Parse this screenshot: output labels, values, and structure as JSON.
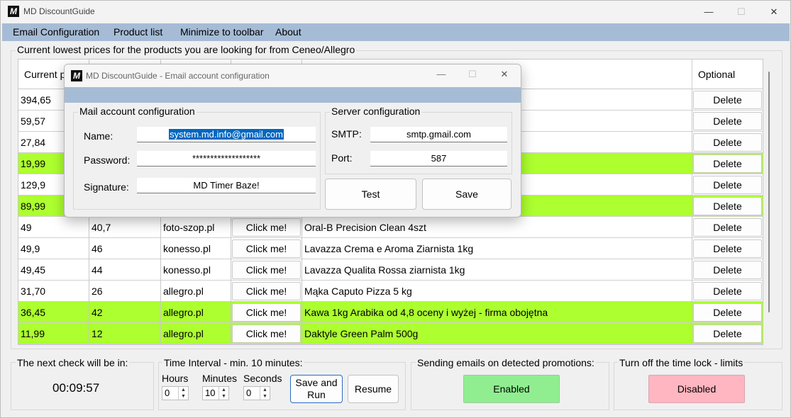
{
  "window": {
    "title": "MD DiscountGuide",
    "controls": {
      "minimize": "—",
      "maximize": "☐",
      "close": "✕"
    }
  },
  "menu": [
    "Email Configuration",
    "Product list",
    "Minimize to toolbar",
    "About"
  ],
  "main_group_label": "Current lowest prices for the products you are looking for from Ceneo/Allegro",
  "table": {
    "headers": [
      "Current p",
      "",
      "",
      "",
      "",
      "Optional"
    ],
    "rows": [
      {
        "price": "394,65",
        "c2": "",
        "shop": "",
        "link": "",
        "name": "",
        "action": "Delete",
        "green": false
      },
      {
        "price": "59,57",
        "c2": "",
        "shop": "",
        "link": "",
        "name": "",
        "action": "Delete",
        "green": false
      },
      {
        "price": "27,84",
        "c2": "",
        "shop": "",
        "link": "",
        "name": "",
        "action": "Delete",
        "green": false
      },
      {
        "price": "19,99",
        "c2": "",
        "shop": "",
        "link": "",
        "name": "",
        "action": "Delete",
        "green": true
      },
      {
        "price": "129,9",
        "c2": "",
        "shop": "",
        "link": "",
        "name": "",
        "action": "Delete",
        "green": false
      },
      {
        "price": "89,99",
        "c2": "",
        "shop": "",
        "link": "",
        "name": "",
        "action": "Delete",
        "green": true
      },
      {
        "price": "49",
        "c2": "40,7",
        "shop": "foto-szop.pl",
        "link": "Click me!",
        "name": "Oral-B Precision Clean 4szt",
        "action": "Delete",
        "green": false
      },
      {
        "price": "49,9",
        "c2": "46",
        "shop": "konesso.pl",
        "link": "Click me!",
        "name": "Lavazza Crema e Aroma Ziarnista 1kg",
        "action": "Delete",
        "green": false
      },
      {
        "price": "49,45",
        "c2": "44",
        "shop": "konesso.pl",
        "link": "Click me!",
        "name": "Lavazza Qualita Rossa ziarnista 1kg",
        "action": "Delete",
        "green": false
      },
      {
        "price": "31,70",
        "c2": "26",
        "shop": "allegro.pl",
        "link": "Click me!",
        "name": "Mąka Caputo Pizza 5 kg",
        "action": "Delete",
        "green": false
      },
      {
        "price": "36,45",
        "c2": "42",
        "shop": "allegro.pl",
        "link": "Click me!",
        "name": "Kawa 1kg Arabika od 4,8 oceny i wyżej - firma obojętna",
        "action": "Delete",
        "green": true
      },
      {
        "price": "11,99",
        "c2": "12",
        "shop": "allegro.pl",
        "link": "Click me!",
        "name": "Daktyle Green Palm 500g",
        "action": "Delete",
        "green": true
      }
    ]
  },
  "next_check": {
    "label": "The next check will be in:",
    "value": "00:09:57"
  },
  "interval": {
    "label": "Time Interval - min. 10 minutes:",
    "hours_label": "Hours",
    "hours": "0",
    "minutes_label": "Minutes",
    "minutes": "10",
    "seconds_label": "Seconds",
    "seconds": "0",
    "save_run": "Save and Run",
    "resume": "Resume"
  },
  "emails": {
    "label": "Sending emails on detected promotions:",
    "button": "Enabled",
    "color": "#90ee90"
  },
  "timelock": {
    "label": "Turn off the time lock - limits",
    "button": "Disabled",
    "color": "#ffb6c1"
  },
  "dialog": {
    "title": "MD DiscountGuide - Email account configuration",
    "mail_group": "Mail account configuration",
    "name_label": "Name:",
    "name_value": "system.md.info@gmail.com",
    "password_label": "Password:",
    "password_value": "*******************",
    "signature_label": "Signature:",
    "signature_value": "MD Timer Baze!",
    "server_group": "Server configuration",
    "smtp_label": "SMTP:",
    "smtp_value": "smtp.gmail.com",
    "port_label": "Port:",
    "port_value": "587",
    "test": "Test",
    "save": "Save"
  }
}
